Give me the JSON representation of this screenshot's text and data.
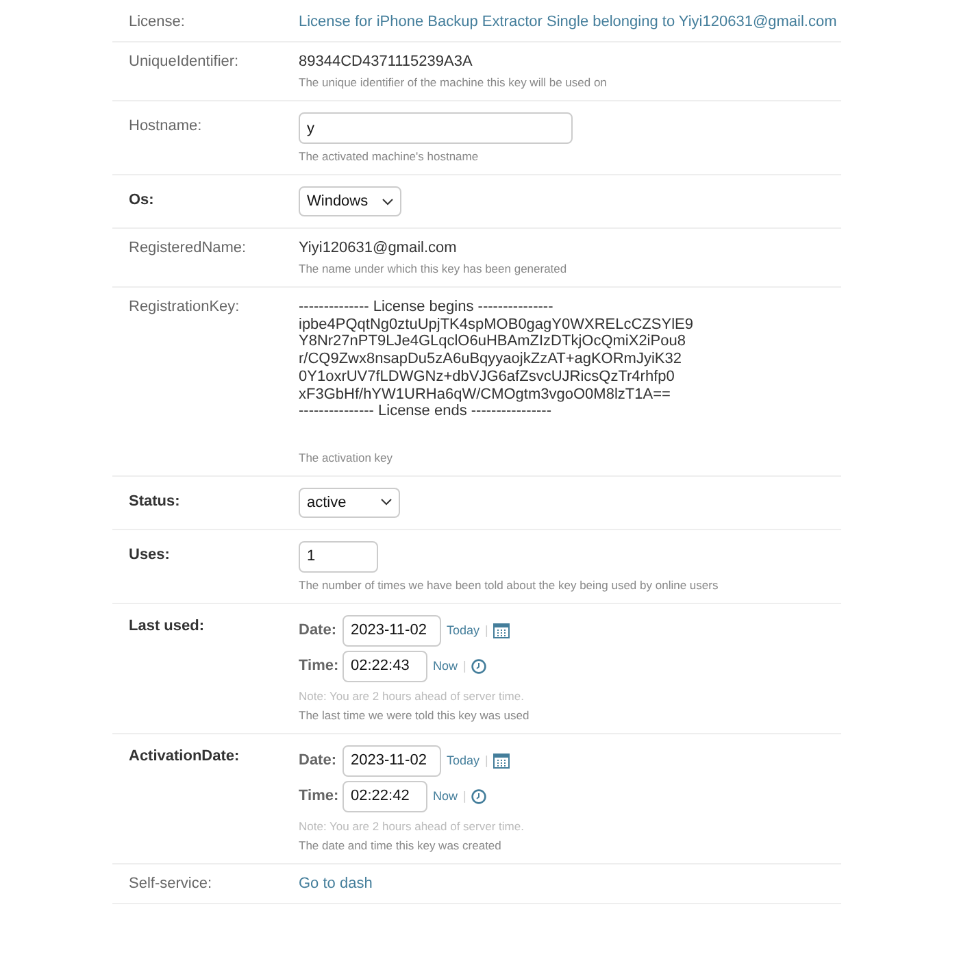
{
  "fields": [
    {
      "kind": "link",
      "label": "License:",
      "required": false,
      "value": "License for iPhone Backup Extractor Single belonging to Yiyi120631@gmail.com"
    },
    {
      "kind": "readonly",
      "label": "UniqueIdentifier:",
      "required": false,
      "value": "89344CD4371115239A3A",
      "help": "The unique identifier of the machine this key will be used on"
    },
    {
      "kind": "text",
      "label": "Hostname:",
      "required": false,
      "value": "y",
      "help": "The activated machine's hostname"
    },
    {
      "kind": "select",
      "label": "Os:",
      "required": true,
      "value": "Windows"
    },
    {
      "kind": "readonly",
      "label": "RegisteredName:",
      "required": false,
      "value": "Yiyi120631@gmail.com",
      "help": "The name under which this key has been generated"
    },
    {
      "kind": "block",
      "label": "RegistrationKey:",
      "required": false,
      "lines": [
        "-------------- License begins ---------------",
        "ipbe4PQqtNg0ztuUpjTK4spMOB0gagY0WXRELcCZSYlE9",
        "Y8Nr27nPT9LJe4GLqclO6uHBAmZIzDTkjOcQmiX2iPou8",
        "r/CQ9Zwx8nsapDu5zA6uBqyyaojkZzAT+agKORmJyiK32",
        "0Y1oxrUV7fLDWGNz+dbVJG6afZsvcUJRicsQzTr4rhfp0",
        "xF3GbHf/hYW1URHa6qW/CMOgtm3vgoO0M8lzT1A==",
        "--------------- License ends ----------------"
      ],
      "help": "The activation key"
    },
    {
      "kind": "select",
      "label": "Status:",
      "required": true,
      "value": "active"
    },
    {
      "kind": "number",
      "label": "Uses:",
      "required": true,
      "value": "1",
      "help": "The number of times we have been told about the key being used by online users"
    },
    {
      "kind": "datetime",
      "label": "Last used:",
      "required": true,
      "date_label": "Date:",
      "date": "2023-11-02",
      "today": "Today",
      "time_label": "Time:",
      "time": "02:22:43",
      "now": "Now",
      "separator": "|",
      "note": "Note: You are 2 hours ahead of server time.",
      "help": "The last time we were told this key was used"
    },
    {
      "kind": "datetime",
      "label": "ActivationDate:",
      "required": true,
      "date_label": "Date:",
      "date": "2023-11-02",
      "today": "Today",
      "time_label": "Time:",
      "time": "02:22:42",
      "now": "Now",
      "separator": "|",
      "note": "Note: You are 2 hours ahead of server time.",
      "help": "The date and time this key was created"
    },
    {
      "kind": "link",
      "label": "Self-service:",
      "required": false,
      "value": "Go to dash"
    }
  ]
}
